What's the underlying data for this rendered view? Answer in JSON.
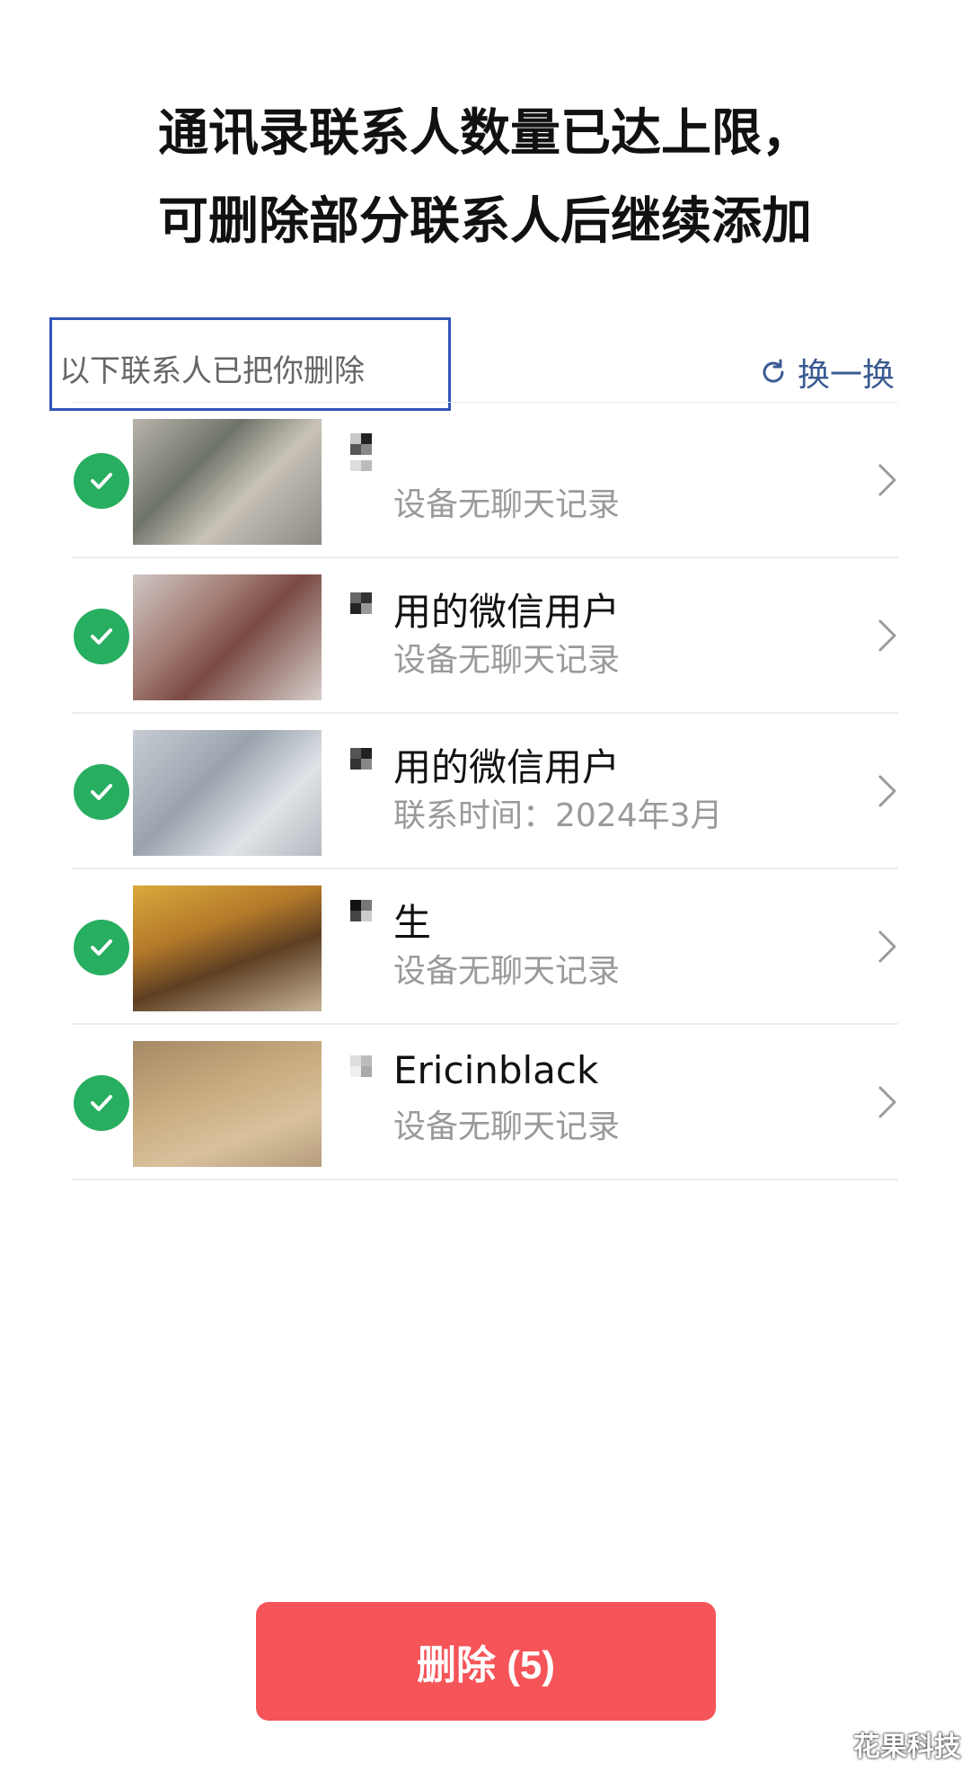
{
  "title": {
    "line1": "通讯录联系人数量已达上限，",
    "line2": "可删除部分联系人后继续添加"
  },
  "section": {
    "label": "以下联系人已把你删除",
    "refresh_label": "换一换",
    "refresh_icon": "refresh-icon"
  },
  "contacts": [
    {
      "name": "",
      "subtitle": "设备无聊天记录",
      "checked": true
    },
    {
      "name": "用的微信用户",
      "subtitle": "设备无聊天记录",
      "checked": true
    },
    {
      "name": "用的微信用户",
      "subtitle": "联系时间：2024年3月",
      "checked": true
    },
    {
      "name": "生",
      "subtitle": "设备无聊天记录",
      "checked": true
    },
    {
      "name": "Ericinblack",
      "subtitle": "设备无聊天记录",
      "checked": true
    }
  ],
  "delete_button": {
    "label": "删除 (5)"
  },
  "watermark": "花果科技",
  "colors": {
    "accent_green": "#27ae60",
    "delete_red": "#f55458",
    "link_blue": "#3b5b92",
    "highlight_border": "#3255b8"
  }
}
